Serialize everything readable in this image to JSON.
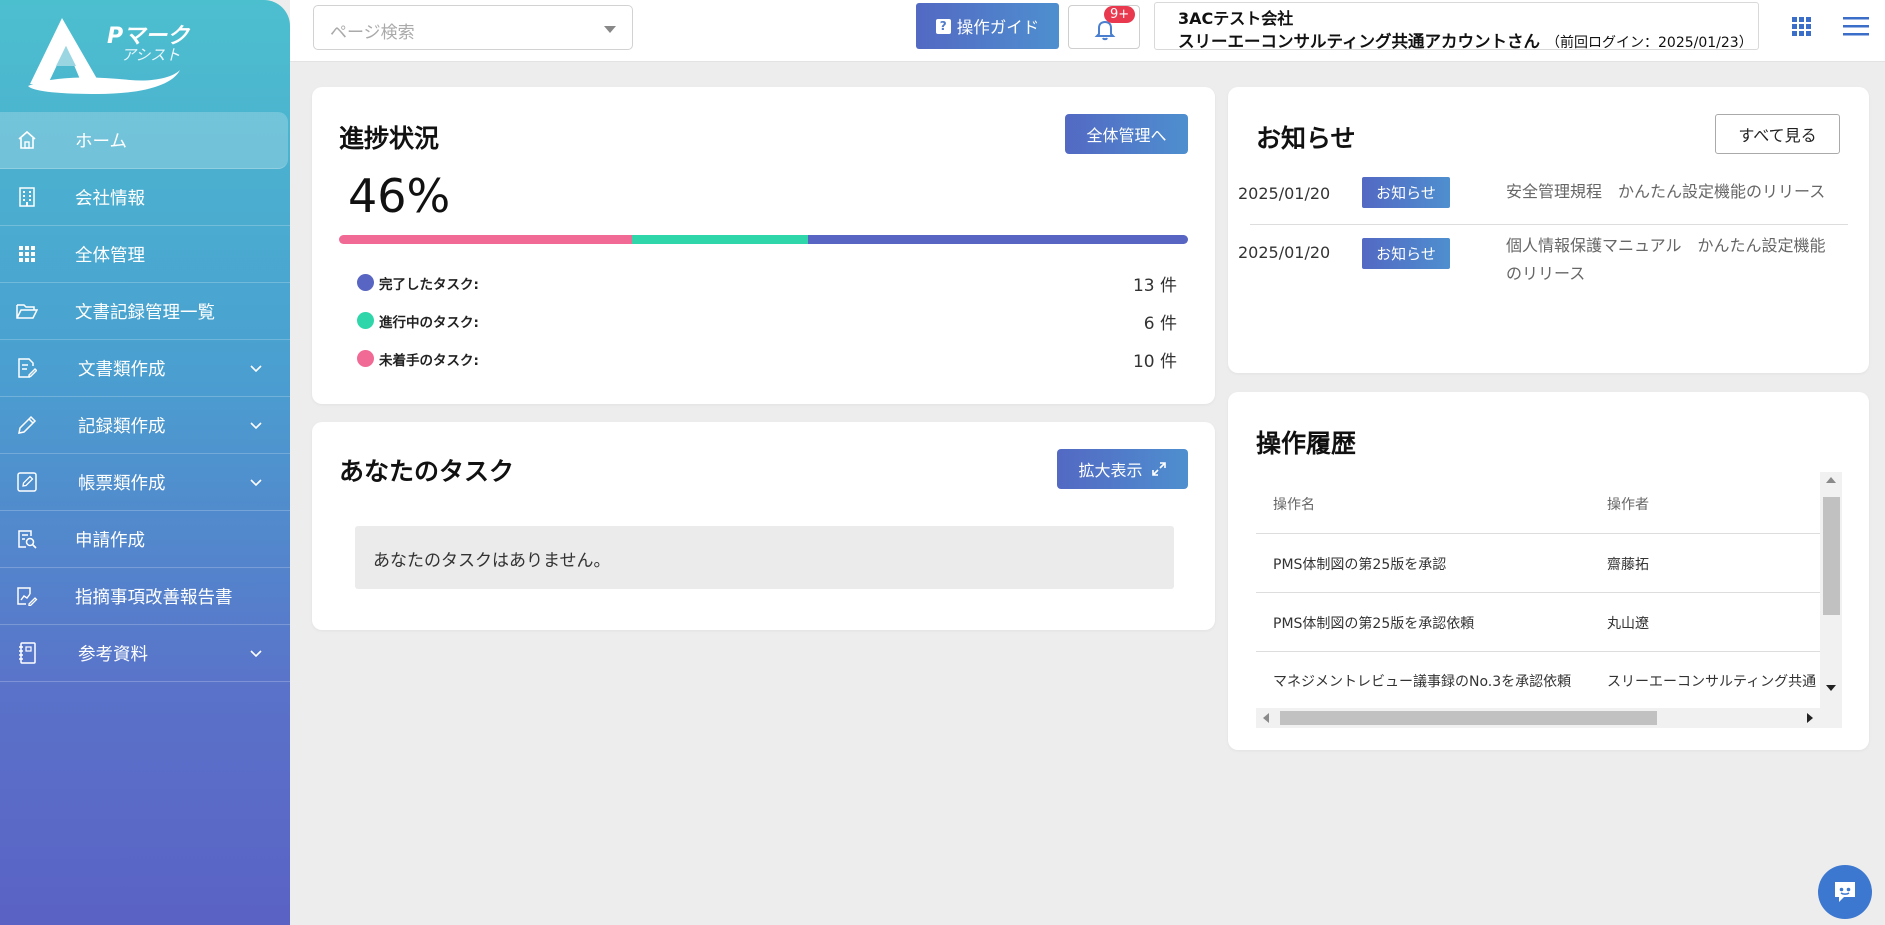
{
  "app": {
    "logo_text": "Pマーク",
    "logo_sub": "アシスト"
  },
  "sidebar": {
    "items": [
      {
        "label": "ホーム",
        "icon": "home-icon",
        "active": true,
        "expandable": false
      },
      {
        "label": "会社情報",
        "icon": "building-icon",
        "active": false,
        "expandable": false
      },
      {
        "label": "全体管理",
        "icon": "grid-dots-icon",
        "active": false,
        "expandable": false
      },
      {
        "label": "文書記録管理一覧",
        "icon": "folder-open-icon",
        "active": false,
        "expandable": false
      },
      {
        "label": "文書類作成",
        "icon": "document-edit-icon",
        "active": false,
        "expandable": true
      },
      {
        "label": "記録類作成",
        "icon": "pencil-icon",
        "active": false,
        "expandable": true
      },
      {
        "label": "帳票類作成",
        "icon": "square-pen-icon",
        "active": false,
        "expandable": true
      },
      {
        "label": "申請作成",
        "icon": "document-search-icon",
        "active": false,
        "expandable": false
      },
      {
        "label": "指摘事項改善報告書",
        "icon": "chart-report-icon",
        "active": false,
        "expandable": false
      },
      {
        "label": "参考資料",
        "icon": "notebook-icon",
        "active": false,
        "expandable": true
      }
    ]
  },
  "header": {
    "search_placeholder": "ページ検索",
    "guide_label": "操作ガイド",
    "notification_badge": "9+",
    "company": "3ACテスト会社",
    "user_name": "スリーエーコンサルティング共通アカウントさん",
    "last_login": "（前回ログイン：2025/01/23）"
  },
  "progress": {
    "title": "進捗状況",
    "button_label": "全体管理へ",
    "percent_text": "46%",
    "bar_fractions": {
      "not_started": 0.345,
      "in_progress": 0.207,
      "completed": 0.448
    },
    "colors": {
      "completed": "#5865c2",
      "in_progress": "#2fd6a9",
      "not_started": "#f06a95"
    },
    "stats": [
      {
        "label": "完了したタスク:",
        "value": "13 件",
        "color": "#5865c2"
      },
      {
        "label": "進行中のタスク:",
        "value": "6 件",
        "color": "#2fd6a9"
      },
      {
        "label": "未着手のタスク:",
        "value": "10 件",
        "color": "#f06a95"
      }
    ]
  },
  "tasks": {
    "title": "あなたのタスク",
    "button_label": "拡大表示",
    "empty_text": "あなたのタスクはありません。"
  },
  "news": {
    "title": "お知らせ",
    "button_label": "すべて見る",
    "items": [
      {
        "date": "2025/01/20",
        "badge": "お知らせ",
        "text": "安全管理規程　かんたん設定機能のリリース"
      },
      {
        "date": "2025/01/20",
        "badge": "お知らせ",
        "text": "個人情報保護マニュアル　かんたん設定機能のリリース"
      }
    ]
  },
  "history": {
    "title": "操作履歴",
    "columns": [
      "操作名",
      "操作者"
    ],
    "rows": [
      [
        "PMS体制図の第25版を承認",
        "齋藤拓"
      ],
      [
        "PMS体制図の第25版を承認依頼",
        "丸山遼"
      ],
      [
        "マネジメントレビュー議事録のNo.3を承認依頼",
        "スリーエーコンサルティング共通"
      ]
    ]
  },
  "colors": {
    "accent": "#5369c3",
    "accent2": "#4e8fcf",
    "badge_red": "#e8394f",
    "chat_blue": "#3d78d0"
  }
}
